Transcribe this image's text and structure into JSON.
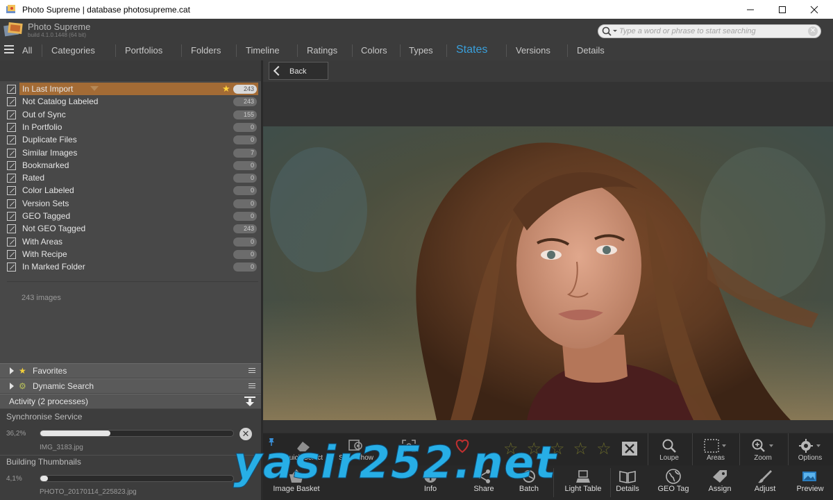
{
  "window": {
    "title": "Photo Supreme | database photosupreme.cat"
  },
  "header": {
    "app_name": "Photo Supreme",
    "build": "build 4.1.0.1448 (64 bit)",
    "search_placeholder": "Type a word or phrase to start searching"
  },
  "tabs": [
    {
      "label": "All"
    },
    {
      "label": "Categories"
    },
    {
      "label": "Portfolios"
    },
    {
      "label": "Folders"
    },
    {
      "label": "Timeline"
    },
    {
      "label": "Ratings"
    },
    {
      "label": "Colors"
    },
    {
      "label": "Types"
    },
    {
      "label": "States",
      "active": true
    },
    {
      "label": "Versions"
    },
    {
      "label": "Details"
    }
  ],
  "back_button": {
    "label": "Back"
  },
  "states": [
    {
      "label": "In Last Import",
      "count": "243",
      "selected": true
    },
    {
      "label": "Not Catalog Labeled",
      "count": "243"
    },
    {
      "label": "Out of Sync",
      "count": "155"
    },
    {
      "label": "In Portfolio",
      "count": "0"
    },
    {
      "label": "Duplicate Files",
      "count": "0"
    },
    {
      "label": "Similar Images",
      "count": "7"
    },
    {
      "label": "Bookmarked",
      "count": "0"
    },
    {
      "label": "Rated",
      "count": "0"
    },
    {
      "label": "Color Labeled",
      "count": "0"
    },
    {
      "label": "Version Sets",
      "count": "0"
    },
    {
      "label": "GEO Tagged",
      "count": "0"
    },
    {
      "label": "Not GEO Tagged",
      "count": "243"
    },
    {
      "label": "With Areas",
      "count": "0"
    },
    {
      "label": "With Recipe",
      "count": "0"
    },
    {
      "label": "In Marked Folder",
      "count": "0"
    }
  ],
  "image_count": "243 images",
  "accordions": {
    "favorites": "Favorites",
    "dynamic_search": "Dynamic Search"
  },
  "activity": {
    "title": "Activity (2 processes)",
    "processes": [
      {
        "name": "Synchronise Service",
        "percent_label": "36,2%",
        "progress": 0.362,
        "file": "IMG_3183.jpg"
      },
      {
        "name": "Building Thumbnails",
        "percent_label": "4,1%",
        "progress": 0.041,
        "file": "PHOTO_20170114_225823.jpg"
      }
    ]
  },
  "toolbar_top": {
    "quick_select": "Quick Select",
    "slide_show": "Slide Show",
    "loupe": "Loupe",
    "areas": "Areas",
    "zoom": "Zoom",
    "options": "Options"
  },
  "toolbar_bottom": {
    "image_basket": "Image Basket",
    "info": "Info",
    "share": "Share",
    "batch": "Batch",
    "light_table": "Light Table",
    "details": "Details",
    "geo_tag": "GEO Tag",
    "assign": "Assign",
    "adjust": "Adjust",
    "preview": "Preview"
  },
  "watermark": "yasir252.net",
  "colors": {
    "accent": "#3aa0dc",
    "selection": "#a36b35",
    "panel": "#484848"
  }
}
